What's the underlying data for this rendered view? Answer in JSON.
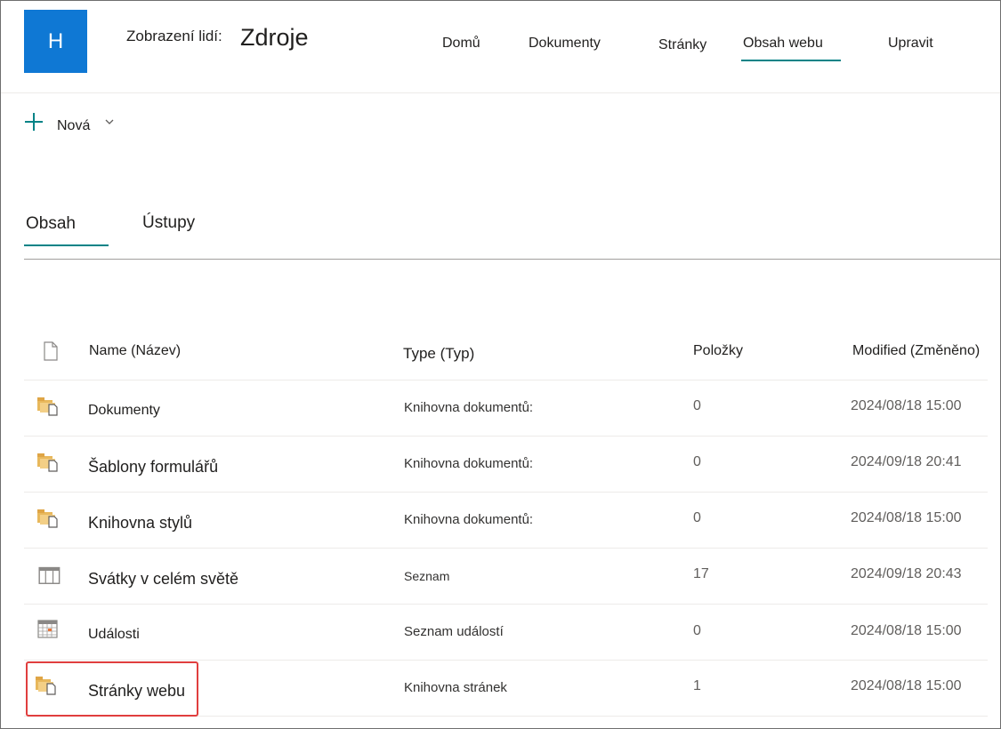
{
  "header": {
    "logo_letter": "H",
    "site_prefix": "Zobrazení lidí:",
    "site_name": "Zdroje",
    "nav": [
      {
        "label": "Domů"
      },
      {
        "label": "Dokumenty"
      },
      {
        "label": "Stránky"
      },
      {
        "label": "Obsah webu",
        "active": true
      },
      {
        "label": "Upravit"
      }
    ]
  },
  "command_bar": {
    "new_label": "Nová"
  },
  "pivots": [
    {
      "label": "Obsah",
      "active": true
    },
    {
      "label": "Ústupy"
    }
  ],
  "table": {
    "columns": {
      "name": "Name (Název)",
      "type": "Type (Typ)",
      "items": "Položky",
      "modified": "Modified (Změněno)"
    },
    "rows": [
      {
        "icon": "document-library-icon",
        "name": "Dokumenty",
        "type": "Knihovna dokumentů:",
        "items": "0",
        "modified": "2024/08/18 15:00"
      },
      {
        "icon": "document-library-icon",
        "name": "Šablony formulářů",
        "type": "Knihovna dokumentů:",
        "items": "0",
        "modified": "2024/09/18 20:41"
      },
      {
        "icon": "document-library-icon",
        "name": "Knihovna stylů",
        "type": "Knihovna dokumentů:",
        "items": "0",
        "modified": "2024/08/18 15:00"
      },
      {
        "icon": "list-icon",
        "name": "Svátky v celém světě",
        "type": "Seznam",
        "items": "17",
        "modified": "2024/09/18 20:43"
      },
      {
        "icon": "calendar-icon",
        "name": "Události",
        "type": "Seznam událostí",
        "items": "0",
        "modified": "2024/08/18 15:00"
      },
      {
        "icon": "document-library-icon",
        "name": "Stránky webu",
        "type": "Knihovna stránek",
        "items": "1",
        "modified": "2024/08/18 15:00"
      }
    ]
  },
  "colors": {
    "brand": "#0f78d4",
    "accent": "#038387",
    "highlight": "#e03e3e"
  }
}
